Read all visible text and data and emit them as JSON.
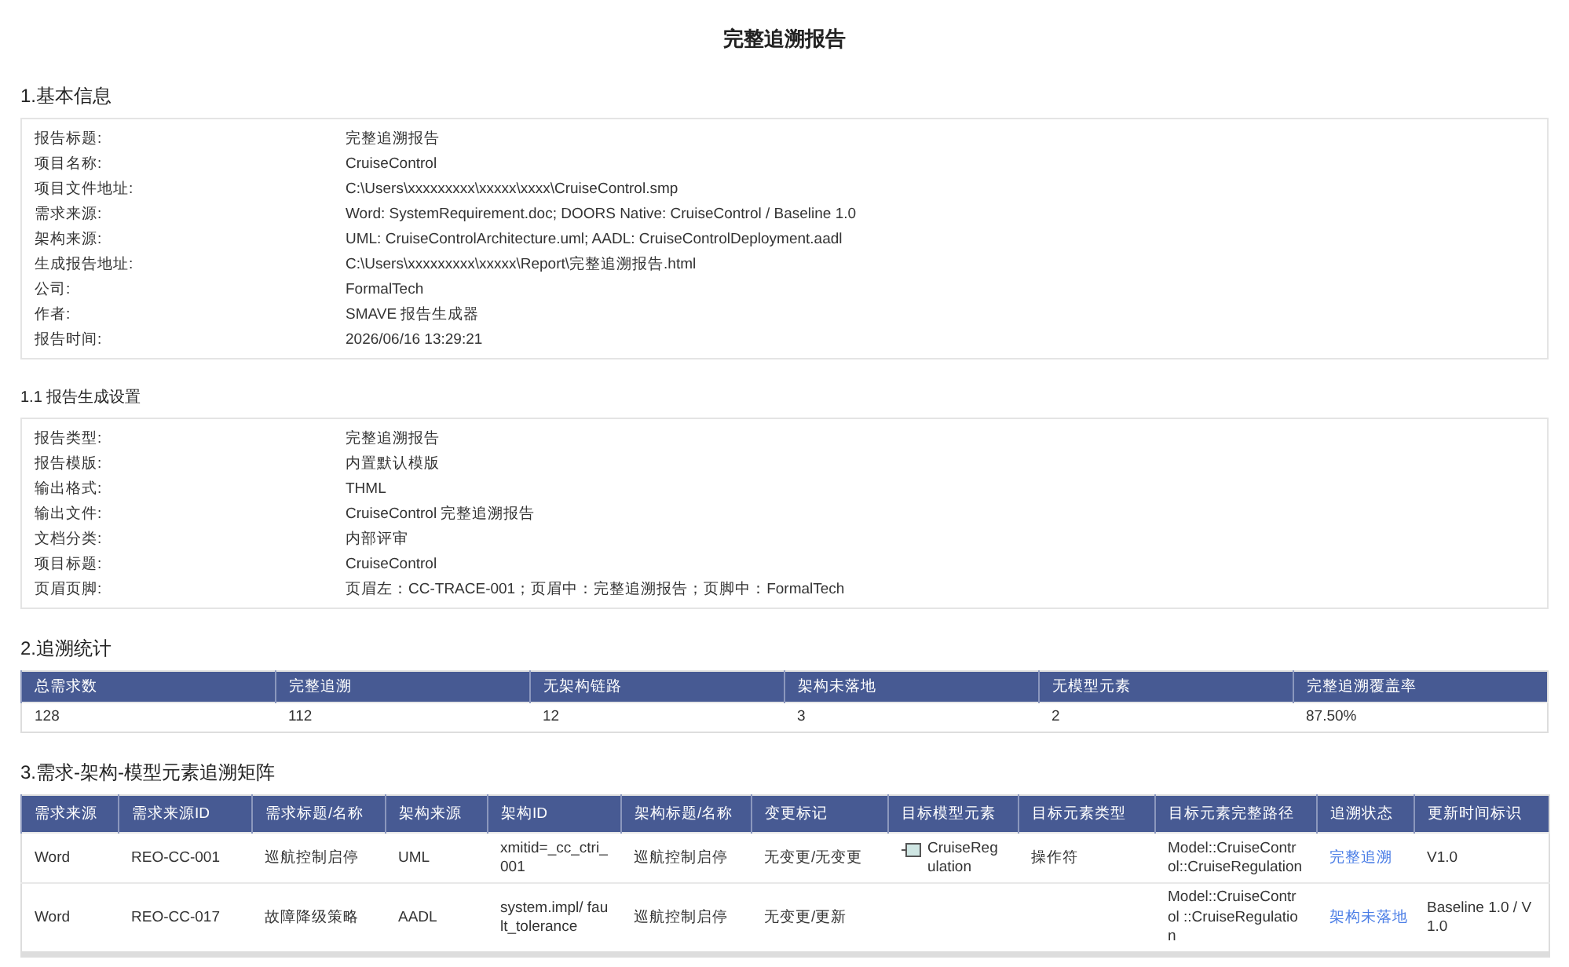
{
  "title": "完整追溯报告",
  "basic_info": {
    "heading": "1.基本信息",
    "rows": [
      {
        "label": "报告标题:",
        "value": "完整追溯报告"
      },
      {
        "label": "项目名称:",
        "value": "CruiseControl"
      },
      {
        "label": "项目文件地址:",
        "value": "C:\\Users\\xxxxxxxxx\\xxxxx\\xxxx\\CruiseControl.smp"
      },
      {
        "label": "需求来源:",
        "value": "Word: SystemRequirement.doc; DOORS Native: CruiseControl / Baseline 1.0"
      },
      {
        "label": "架构来源:",
        "value": "UML: CruiseControlArchitecture.uml; AADL: CruiseControlDeployment.aadl"
      },
      {
        "label": "生成报告地址:",
        "value": "C:\\Users\\xxxxxxxxx\\xxxxx\\Report\\完整追溯报告.html"
      },
      {
        "label": "公司:",
        "value": "FormalTech"
      },
      {
        "label": "作者:",
        "value": "SMAVE 报告生成器"
      },
      {
        "label": "报告时间:",
        "value": "2026/06/16 13:29:21"
      }
    ]
  },
  "settings": {
    "heading": "1.1 报告生成设置",
    "rows": [
      {
        "label": "报告类型:",
        "value": "完整追溯报告"
      },
      {
        "label": "报告模版:",
        "value": "内置默认模版"
      },
      {
        "label": "输出格式:",
        "value": "THML"
      },
      {
        "label": "输出文件:",
        "value": "CruiseControl 完整追溯报告"
      },
      {
        "label": "文档分类:",
        "value": "内部评审"
      },
      {
        "label": "项目标题:",
        "value": "CruiseControl"
      },
      {
        "label": "页眉页脚:",
        "value": "页眉左：CC-TRACE-001；页眉中：完整追溯报告；页脚中：FormalTech"
      }
    ]
  },
  "statistics": {
    "heading": "2.追溯统计",
    "columns": [
      "总需求数",
      "完整追溯",
      "无架构链路",
      "架构未落地",
      "无模型元素",
      "完整追溯覆盖率"
    ],
    "values": [
      "128",
      "112",
      "12",
      "3",
      "2",
      "87.50%"
    ]
  },
  "matrix": {
    "heading": "3.需求-架构-模型元素追溯矩阵",
    "columns": [
      "需求来源",
      "需求来源ID",
      "需求标题/名称",
      "架构来源",
      "架构ID",
      "架构标题/名称",
      "变更标记",
      "目标模型元素",
      "目标元素类型",
      "目标元素完整路径",
      "追溯状态",
      "更新时间标识"
    ],
    "rows": [
      {
        "cells": [
          "Word",
          "REO-CC-001",
          "巡航控制启停",
          "UML",
          "xmitid=_cc_ctri_001",
          "巡航控制启停",
          "无变更/无变更",
          "CruiseRegulation",
          "操作符",
          "Model::CruiseControl::CruiseRegulation",
          "完整追溯",
          "V1.0"
        ]
      },
      {
        "cells": [
          "Word",
          "REO-CC-017",
          "故障降级策略",
          "AADL",
          "system.impl/ fault_tolerance",
          "巡航控制启停",
          "无变更/更新",
          "",
          "",
          "Model::CruiseControl ::CruiseRegulation",
          "架构未落地",
          "Baseline 1.0 / V1.0"
        ]
      }
    ]
  }
}
